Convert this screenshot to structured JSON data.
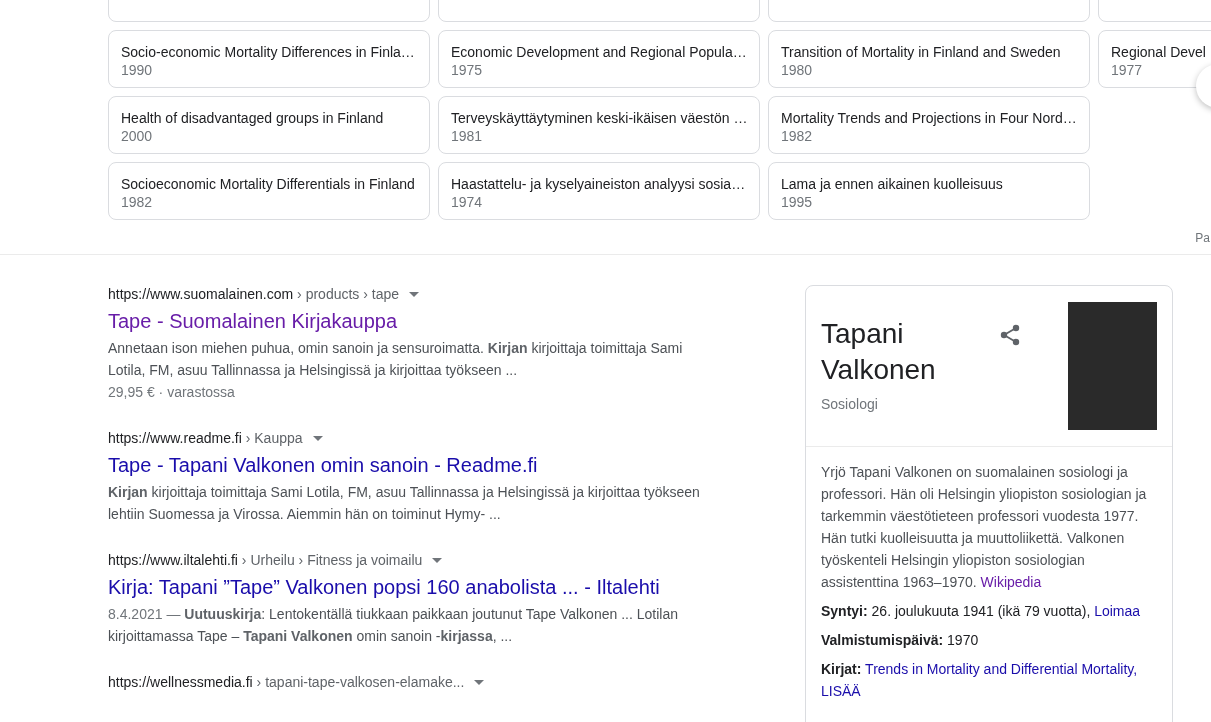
{
  "book_columns": [
    [
      {
        "title": "Socio-economic Mortality Differences in Finla…",
        "year": "1990"
      },
      {
        "title": "Health of disadvantaged groups in Finland",
        "year": "2000"
      },
      {
        "title": "Socioeconomic Mortality Differentials in Finland",
        "year": "1982"
      }
    ],
    [
      {
        "title": "Economic Development and Regional Popula…",
        "year": "1975"
      },
      {
        "title": "Terveyskäyttäytyminen keski-ikäisen väestön …",
        "year": "1981"
      },
      {
        "title": "Haastattelu- ja kyselyaineiston analyysi sosia…",
        "year": "1974"
      }
    ],
    [
      {
        "title": "Transition of Mortality in Finland and Sweden",
        "year": "1980"
      },
      {
        "title": "Mortality Trends and Projections in Four Nord…",
        "year": "1982"
      },
      {
        "title": "Lama ja ennen aikainen kuolleisuus",
        "year": "1995"
      }
    ],
    [
      {
        "title": "Regional Devel",
        "year": "1977"
      }
    ]
  ],
  "feedback_link": "Pa",
  "results": [
    {
      "site": "https://www.suomalainen.com",
      "path": " › products › tape",
      "title": "Tape - Suomalainen Kirjakauppa",
      "visited": true,
      "snippet": "Annetaan ison miehen puhua, omin sanoin ja sensuroimatta. **Kirjan** kirjoittaja toimittaja Sami Lotila, FM, asuu Tallinnassa ja Helsingissä ja kirjoittaa työkseen ...",
      "extra": "29,95 € · varastossa"
    },
    {
      "site": "https://www.readme.fi",
      "path": " › Kauppa",
      "title": "Tape - Tapani Valkonen omin sanoin - Readme.fi",
      "visited": false,
      "snippet": "**Kirjan** kirjoittaja toimittaja Sami Lotila, FM, asuu Tallinnassa ja Helsingissä ja kirjoittaa työkseen lehtiin Suomessa ja Virossa. Aiemmin hän on toiminut Hymy- ..."
    },
    {
      "site": "https://www.iltalehti.fi",
      "path": " › Urheilu › Fitness ja voimailu",
      "title": "Kirja: Tapani ”Tape” Valkonen popsi 160 anabolista ... - Iltalehti",
      "visited": false,
      "date": "8.4.2021 — ",
      "snippet": "**Uutuuskirja**: Lentokentällä tiukkaan paikkaan joutunut Tape Valkonen ... Lotilan kirjoittamassa Tape – **Tapani Valkonen** omin sanoin -**kirjassa**, ..."
    },
    {
      "site": "https://wellnessmedia.fi",
      "path": " › tapani-tape-valkosen-elamake..."
    }
  ],
  "knowledge_panel": {
    "name": "Tapani Valkonen",
    "subtitle": "Sosiologi",
    "description": "Yrjö Tapani Valkonen on suomalainen sosiologi ja professori. Hän oli Helsingin yliopiston sosiologian ja tarkemmin väestötieteen professori vuodesta 1977. Hän tutki kuolleisuutta ja muuttoliikettä. Valkonen työskenteli Helsingin yliopiston sosiologian assistenttina 1963–1970.",
    "source": "Wikipedia",
    "source_visited": true,
    "facts": [
      {
        "label": "Syntyi:",
        "value": "26. joulukuuta 1941 (ikä 79 vuotta),",
        "links": [
          "Loimaa"
        ]
      },
      {
        "label": "Valmistumispäivä:",
        "value": "1970"
      },
      {
        "label": "Kirjat:",
        "links": [
          "Trends in Mortality and Differential Mortality,",
          "LISÄÄ"
        ]
      }
    ]
  }
}
